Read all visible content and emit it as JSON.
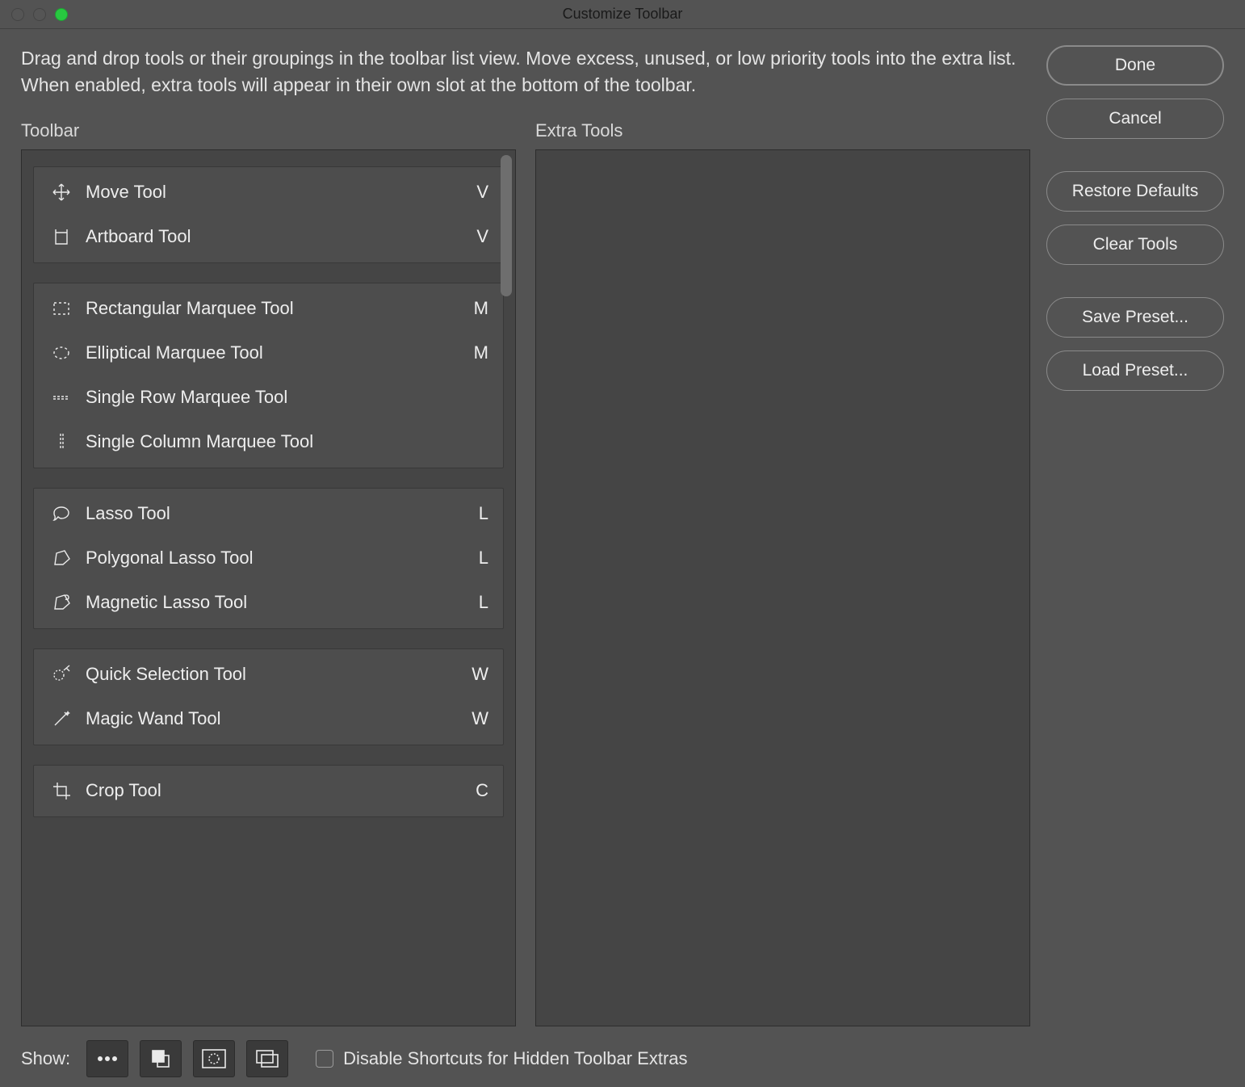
{
  "window": {
    "title": "Customize Toolbar"
  },
  "description": "Drag and drop tools or their groupings in the toolbar list view. Move excess, unused, or low priority tools into the extra list. When enabled, extra tools will appear in their own slot at the bottom of the toolbar.",
  "toolbar_label": "Toolbar",
  "extra_label": "Extra Tools",
  "groups": [
    {
      "tools": [
        {
          "icon": "move",
          "name": "Move Tool",
          "key": "V"
        },
        {
          "icon": "artboard",
          "name": "Artboard Tool",
          "key": "V"
        }
      ]
    },
    {
      "tools": [
        {
          "icon": "rect-marquee",
          "name": "Rectangular Marquee Tool",
          "key": "M"
        },
        {
          "icon": "ellipse-marquee",
          "name": "Elliptical Marquee Tool",
          "key": "M"
        },
        {
          "icon": "row-marquee",
          "name": "Single Row Marquee Tool",
          "key": ""
        },
        {
          "icon": "col-marquee",
          "name": "Single Column Marquee Tool",
          "key": ""
        }
      ]
    },
    {
      "tools": [
        {
          "icon": "lasso",
          "name": "Lasso Tool",
          "key": "L"
        },
        {
          "icon": "poly-lasso",
          "name": "Polygonal Lasso Tool",
          "key": "L"
        },
        {
          "icon": "magnetic-lasso",
          "name": "Magnetic Lasso Tool",
          "key": "L"
        }
      ]
    },
    {
      "tools": [
        {
          "icon": "quick-select",
          "name": "Quick Selection Tool",
          "key": "W"
        },
        {
          "icon": "magic-wand",
          "name": "Magic Wand Tool",
          "key": "W"
        }
      ]
    },
    {
      "tools": [
        {
          "icon": "crop",
          "name": "Crop Tool",
          "key": "C"
        }
      ]
    }
  ],
  "buttons": {
    "done": "Done",
    "cancel": "Cancel",
    "restore": "Restore Defaults",
    "clear": "Clear Tools",
    "save_preset": "Save Preset...",
    "load_preset": "Load Preset..."
  },
  "footer": {
    "show_label": "Show:",
    "checkbox_label": "Disable Shortcuts for Hidden Toolbar Extras",
    "checkbox_checked": false
  }
}
